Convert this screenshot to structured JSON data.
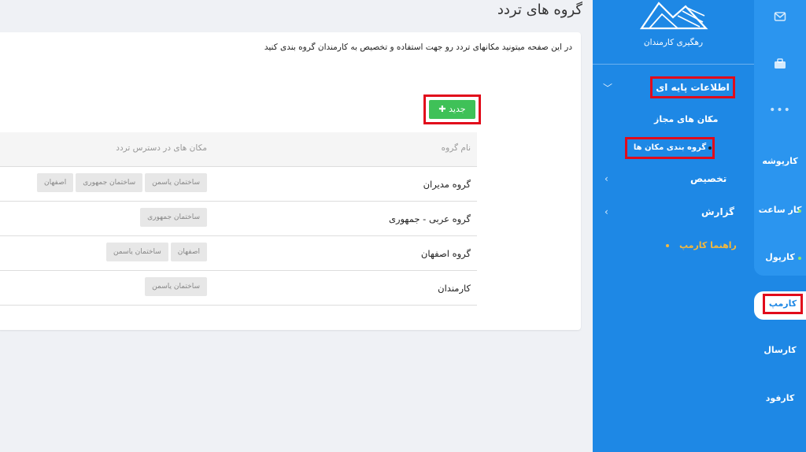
{
  "page": {
    "title": "گروه های تردد",
    "description": "در این صفحه میتونید مکانهای تردد رو جهت استفاده و تخصیص به کارمندان گروه بندی کنید",
    "new_button": "جدید"
  },
  "table": {
    "headers": {
      "name": "نام گروه",
      "places": "مکان های در دسترس تردد"
    },
    "rows": [
      {
        "name": "گروه مدیران",
        "tags": [
          "ساختمان یاسمن",
          "ساختمان جمهوری",
          "اصفهان"
        ]
      },
      {
        "name": "گروه عربی - جمهوری",
        "tags": [
          "ساختمان جمهوری"
        ]
      },
      {
        "name": "گروه اصفهان",
        "tags": [
          "اصفهان",
          "ساختمان یاسمن"
        ]
      },
      {
        "name": "کارمندان",
        "tags": [
          "ساختمان یاسمن"
        ]
      }
    ]
  },
  "sidebar": {
    "brand": "رهگیری کارمندان",
    "section": "اطلاعات پایه ای",
    "sub_items": [
      "مکان های مجاز",
      "گروه بندی مکان ها"
    ],
    "links": [
      "تخصیص",
      "گزارش"
    ],
    "guide": "راهنما کارمپ"
  },
  "rail": {
    "items": [
      "کارپوشه",
      "کار ساعت",
      "کارپول",
      "کارمپ",
      "کارسال",
      "کارفود"
    ],
    "active": "کارمپ",
    "icons": [
      "mail-icon",
      "briefcase-icon",
      "more-dots-icon"
    ]
  },
  "colors": {
    "primary": "#1e88e5",
    "success": "#3fc158",
    "highlight": "#e10b1b",
    "guide": "#f4b83d"
  }
}
